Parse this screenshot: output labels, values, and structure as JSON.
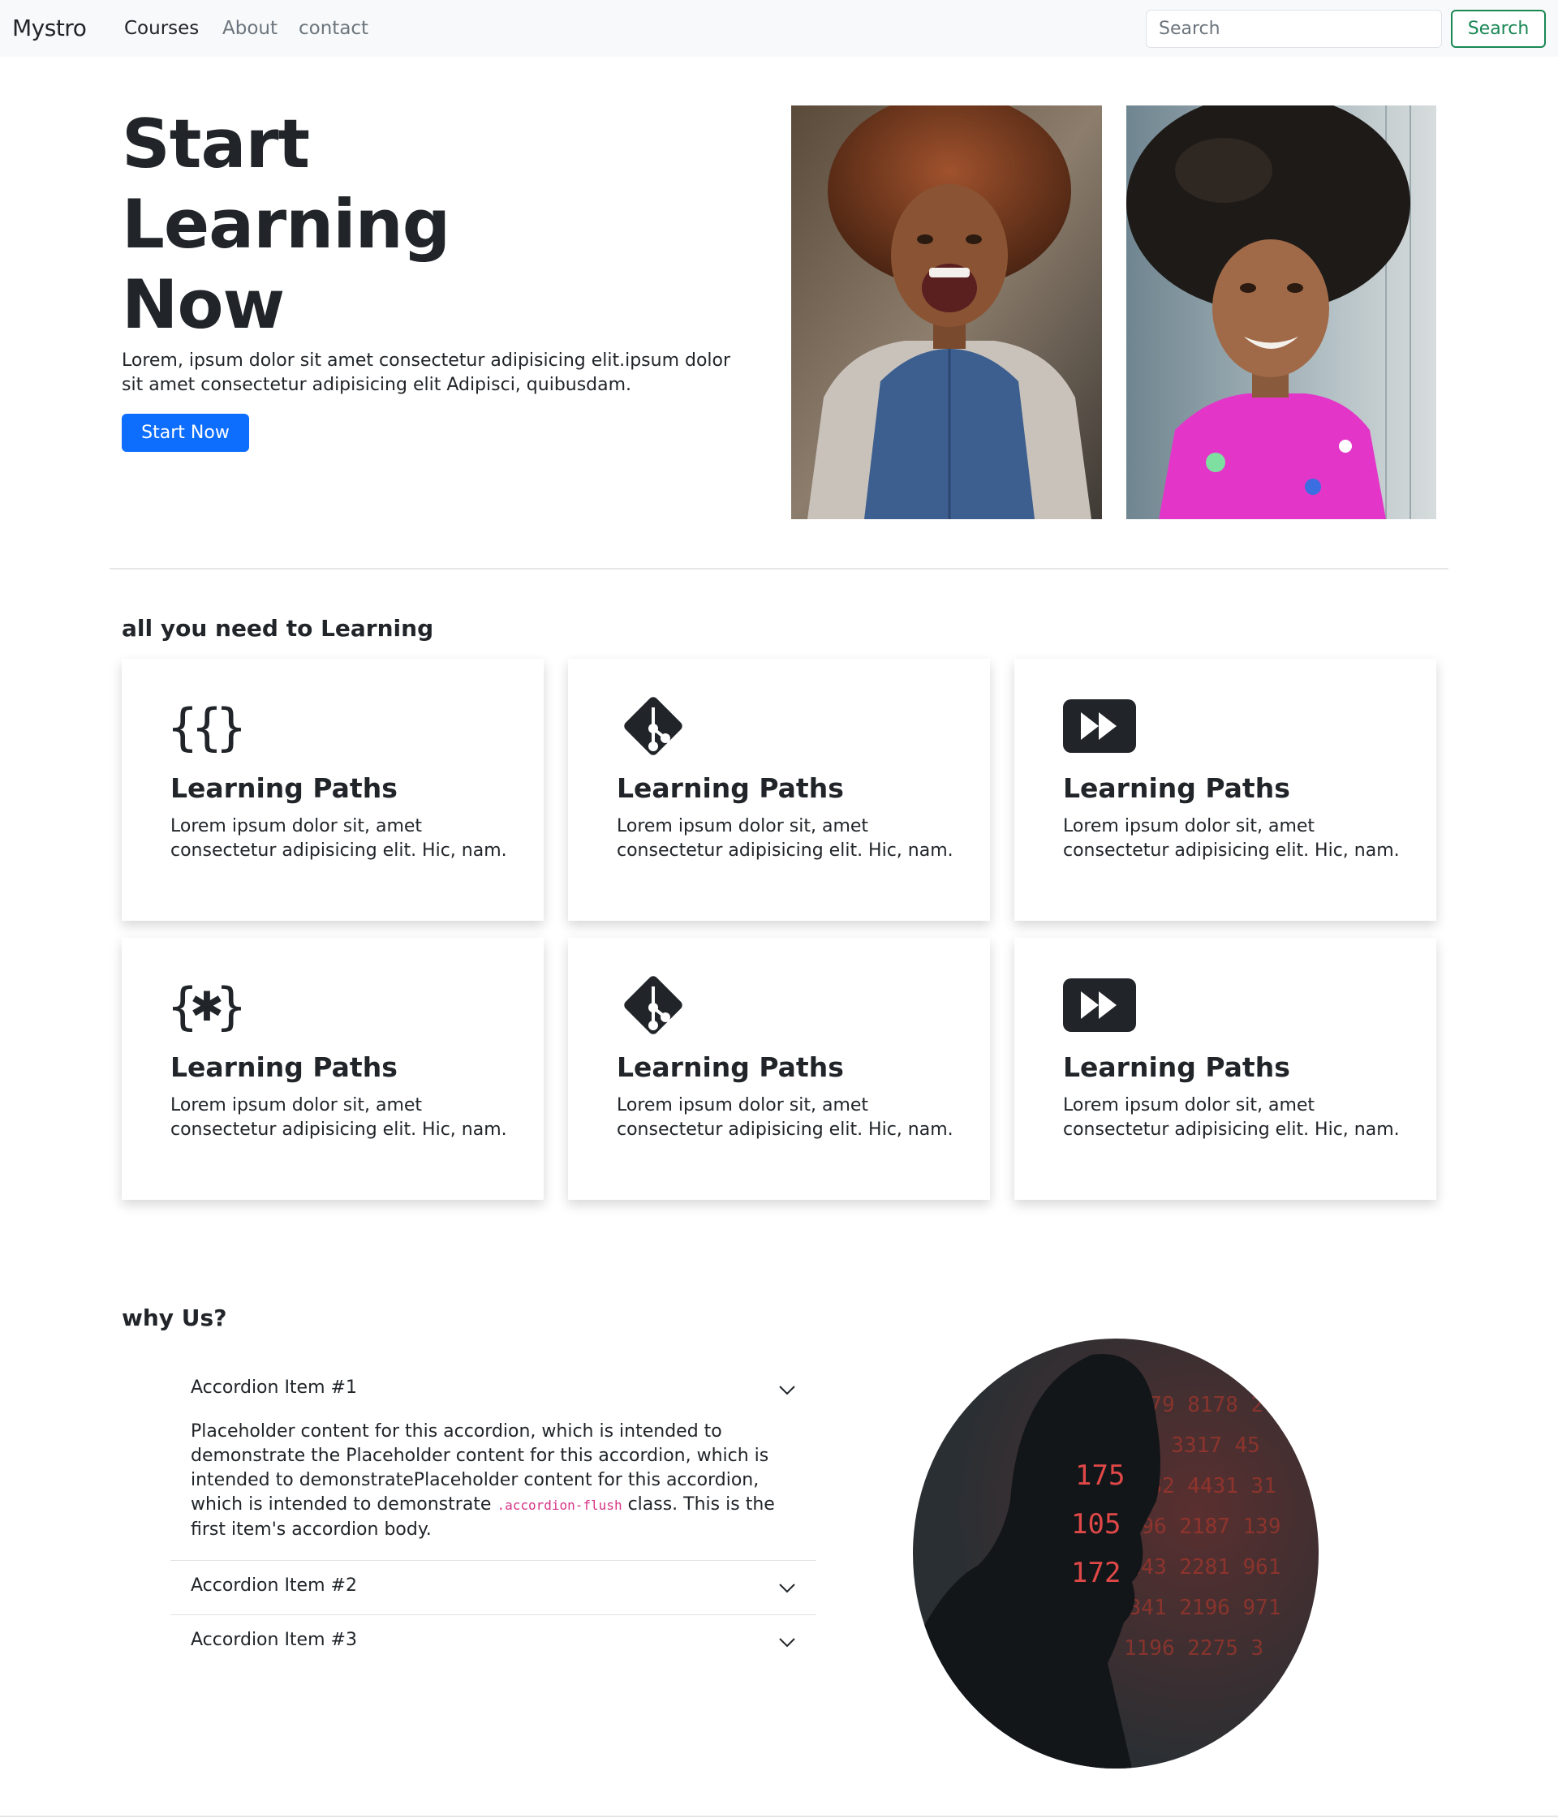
{
  "navbar": {
    "brand": "Mystro",
    "links": [
      "Courses",
      "About",
      "contact"
    ],
    "search_placeholder": "Search",
    "search_button": "Search"
  },
  "hero": {
    "title_lines": [
      "Start",
      "Learning",
      "Now"
    ],
    "text": "Lorem, ipsum dolor sit amet consectetur adipisicing elit.ipsum dolor sit amet consectetur adipisicing elit Adipisci, quibusdam.",
    "button": "Start Now"
  },
  "features": {
    "heading": "all you need to Learning",
    "cards": [
      {
        "icon": "braces-asterisk-icon",
        "title": "Learning Paths",
        "text": "Lorem ipsum dolor sit, amet consectetur adipisicing elit. Hic, nam."
      },
      {
        "icon": "git-icon",
        "title": "Learning Paths",
        "text": "Lorem ipsum dolor sit, amet consectetur adipisicing elit. Hic, nam."
      },
      {
        "icon": "fast-forward-icon",
        "title": "Learning Paths",
        "text": "Lorem ipsum dolor sit, amet consectetur adipisicing elit. Hic, nam."
      },
      {
        "icon": "braces-asterisk-icon",
        "title": "Learning Paths",
        "text": "Lorem ipsum dolor sit, amet consectetur adipisicing elit. Hic, nam."
      },
      {
        "icon": "git-icon",
        "title": "Learning Paths",
        "text": "Lorem ipsum dolor sit, amet consectetur adipisicing elit. Hic, nam."
      },
      {
        "icon": "fast-forward-icon",
        "title": "Learning Paths",
        "text": "Lorem ipsum dolor sit, amet consectetur adipisicing elit. Hic, nam."
      }
    ]
  },
  "why": {
    "heading": "why Us?",
    "accordion": [
      {
        "title": "Accordion Item #1",
        "expanded": true,
        "body_before": "Placeholder content for this accordion, which is intended to demonstrate the Placeholder content for this accordion, which is intended to demonstratePlaceholder content for this accordion, which is intended to demonstrate ",
        "body_code": ".accordion-flush",
        "body_after": " class. This is the first item's accordion body."
      },
      {
        "title": "Accordion Item #2",
        "expanded": false
      },
      {
        "title": "Accordion Item #3",
        "expanded": false
      }
    ]
  },
  "colors": {
    "primary": "#0d6efd",
    "success": "#198754",
    "navbar_bg": "#f8f9fa",
    "text": "#212529"
  }
}
